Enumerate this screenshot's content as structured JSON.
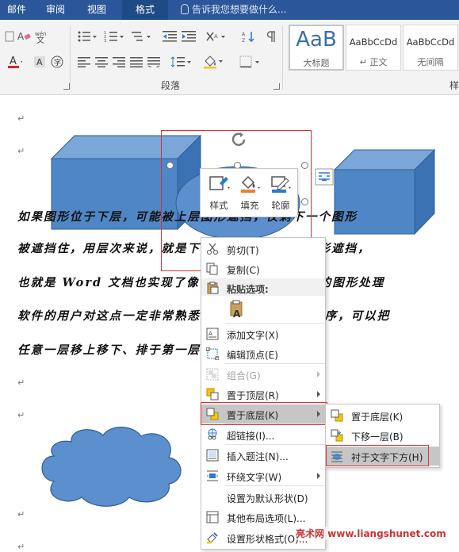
{
  "tabs": [
    {
      "label": "邮件",
      "active": false
    },
    {
      "label": "审阅",
      "active": false
    },
    {
      "label": "视图",
      "active": false
    },
    {
      "label": "格式",
      "active": true
    }
  ],
  "tell_me": "告诉我您想要做什么...",
  "ribbon": {
    "group_paragraph": "段落",
    "group_styles_partial": "样",
    "styles": [
      {
        "sample": "AaB",
        "name": "大标题"
      },
      {
        "sample": "AaBbCcDd",
        "name": "↵ 正文"
      },
      {
        "sample": "AaBbCcDd",
        "name": "无间隔"
      }
    ]
  },
  "document": {
    "lines": [
      "如果图形位于下层，可能被上层图形遮挡，仅剩下一个图形",
      "被遮挡住，用层次来说，就是下面的图形被上面的图形遮挡，",
      "也就是 Word 文档也实现了像 Photoshop 这样的图形处理",
      "软件的用户对这点一定非常熟悉，Word 图形就能排序，可以把",
      "任意一层移上移下、排于第一层或最后一层位。↵"
    ],
    "paragraph_mark": "↵"
  },
  "minibar": {
    "style_label": "样式",
    "fill_label": "填充",
    "outline_label": "轮廓"
  },
  "context_menu": {
    "items": [
      {
        "label": "剪切(T)",
        "icon": "scissors-icon",
        "disabled": false,
        "arrow": false
      },
      {
        "label": "复制(C)",
        "icon": "copy-icon",
        "disabled": false,
        "arrow": false
      },
      {
        "label": "粘贴选项:",
        "icon": "paste-icon",
        "header": true
      },
      {
        "label": "添加文字(X)",
        "icon": "add-text-icon",
        "disabled": false,
        "arrow": false
      },
      {
        "label": "编辑顶点(E)",
        "icon": "edit-points-icon",
        "disabled": false,
        "arrow": false
      },
      {
        "label": "组合(G)",
        "icon": "group-icon",
        "disabled": true,
        "arrow": true
      },
      {
        "label": "置于顶层(R)",
        "icon": "bring-to-front-icon",
        "disabled": false,
        "arrow": true
      },
      {
        "label": "置于底层(K)",
        "icon": "send-to-back-icon",
        "disabled": false,
        "arrow": true,
        "highlighted": true
      },
      {
        "label": "超链接(I)...",
        "icon": "hyperlink-icon",
        "disabled": false,
        "arrow": false
      },
      {
        "label": "插入题注(N)...",
        "icon": "caption-icon",
        "disabled": false,
        "arrow": false
      },
      {
        "label": "环绕文字(W)",
        "icon": "wrap-text-icon",
        "disabled": false,
        "arrow": true
      },
      {
        "label": "设置为默认形状(D)",
        "icon": "",
        "disabled": false,
        "arrow": false
      },
      {
        "label": "其他布局选项(L)...",
        "icon": "layout-options-icon",
        "disabled": false,
        "arrow": false
      },
      {
        "label": "设置形状格式(O)...",
        "icon": "format-shape-icon",
        "disabled": false,
        "arrow": false
      }
    ]
  },
  "submenu": {
    "items": [
      {
        "label": "置于底层(K)",
        "icon": "send-to-back-icon"
      },
      {
        "label": "下移一层(B)",
        "icon": "send-backward-icon"
      },
      {
        "label": "衬于文字下方(H)",
        "icon": "behind-text-icon",
        "highlighted": true
      }
    ]
  },
  "watermark": "亮术网 www.liangshunet.com"
}
